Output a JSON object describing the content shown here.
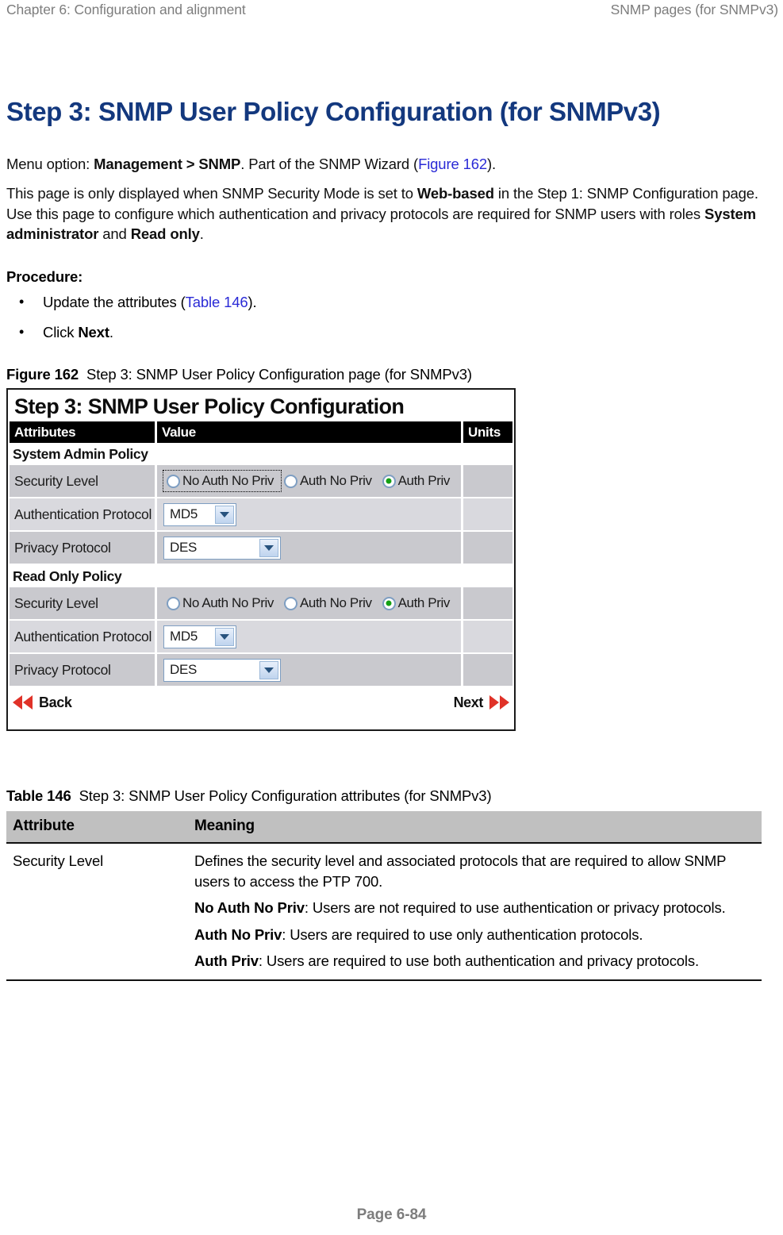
{
  "header": {
    "left": "Chapter 6:  Configuration and alignment",
    "right": "SNMP pages (for SNMPv3)"
  },
  "page_title": "Step 3: SNMP User Policy Configuration (for SNMPv3)",
  "menu_line": {
    "prefix": "Menu option: ",
    "path": "Management > SNMP",
    "middle": ". Part of the SNMP Wizard (",
    "xref": "Figure 162",
    "suffix": ")."
  },
  "description": {
    "s1": "This page is only displayed when SNMP Security Mode is set to ",
    "b1": "Web-based",
    "s2": " in the Step 1: SNMP Configuration page. Use this page to configure which authentication and privacy protocols are required for SNMP users with roles ",
    "b2": "System administrator",
    "s3": " and ",
    "b3": "Read only",
    "s4": "."
  },
  "procedure": {
    "heading": "Procedure:",
    "items": [
      {
        "bullet": "•",
        "pre": "Update the attributes (",
        "xref": "Table 146",
        "post": ")."
      },
      {
        "bullet": "•",
        "pre": "Click ",
        "bold": "Next",
        "post": "."
      }
    ]
  },
  "figure": {
    "label": "Figure 162",
    "caption": "Step 3: SNMP User Policy Configuration page (for SNMPv3)",
    "screenshot": {
      "title": "Step 3: SNMP User Policy Configuration",
      "columns": [
        "Attributes",
        "Value",
        "Units"
      ],
      "sections": [
        {
          "name": "System Admin Policy",
          "rows": [
            {
              "attribute": "Security Level",
              "type": "radio",
              "options": [
                {
                  "label": "No Auth No Priv",
                  "selected": false,
                  "focused": true
                },
                {
                  "label": "Auth No Priv",
                  "selected": false,
                  "focused": false
                },
                {
                  "label": "Auth Priv",
                  "selected": true,
                  "focused": false
                }
              ]
            },
            {
              "attribute": "Authentication Protocol",
              "type": "select",
              "value": "MD5",
              "width": "md5"
            },
            {
              "attribute": "Privacy Protocol",
              "type": "select",
              "value": "DES",
              "width": "des"
            }
          ]
        },
        {
          "name": "Read Only Policy",
          "rows": [
            {
              "attribute": "Security Level",
              "type": "radio",
              "options": [
                {
                  "label": "No Auth No Priv",
                  "selected": false,
                  "focused": false
                },
                {
                  "label": "Auth No Priv",
                  "selected": false,
                  "focused": false
                },
                {
                  "label": "Auth Priv",
                  "selected": true,
                  "focused": false
                }
              ]
            },
            {
              "attribute": "Authentication Protocol",
              "type": "select",
              "value": "MD5",
              "width": "md5"
            },
            {
              "attribute": "Privacy Protocol",
              "type": "select",
              "value": "DES",
              "width": "des"
            }
          ]
        }
      ],
      "nav": {
        "back": "Back",
        "next": "Next"
      },
      "accent_color": "#e03228",
      "selected_radio_color": "#14a014"
    }
  },
  "table": {
    "label": "Table 146",
    "caption": "Step 3: SNMP User Policy Configuration attributes (for SNMPv3)",
    "columns": [
      "Attribute",
      "Meaning"
    ],
    "rows": [
      {
        "attribute": "Security Level",
        "meaning": [
          {
            "text": "Defines the security level and associated protocols that are required to allow SNMP users to access the PTP 700."
          },
          {
            "bold": "No Auth No Priv",
            "text": ": Users are not required to use authentication or privacy protocols."
          },
          {
            "bold": "Auth No Priv",
            "text": ": Users are required to use only authentication protocols."
          },
          {
            "bold": "Auth Priv",
            "text": ": Users are required to use both authentication and privacy protocols."
          }
        ]
      }
    ]
  },
  "footer": {
    "page": "Page 6-84"
  },
  "colors": {
    "title": "#13387e",
    "xref": "#2a2ad6",
    "header_gray": "#7d7d7d",
    "table_header": "#c0c0c0"
  }
}
